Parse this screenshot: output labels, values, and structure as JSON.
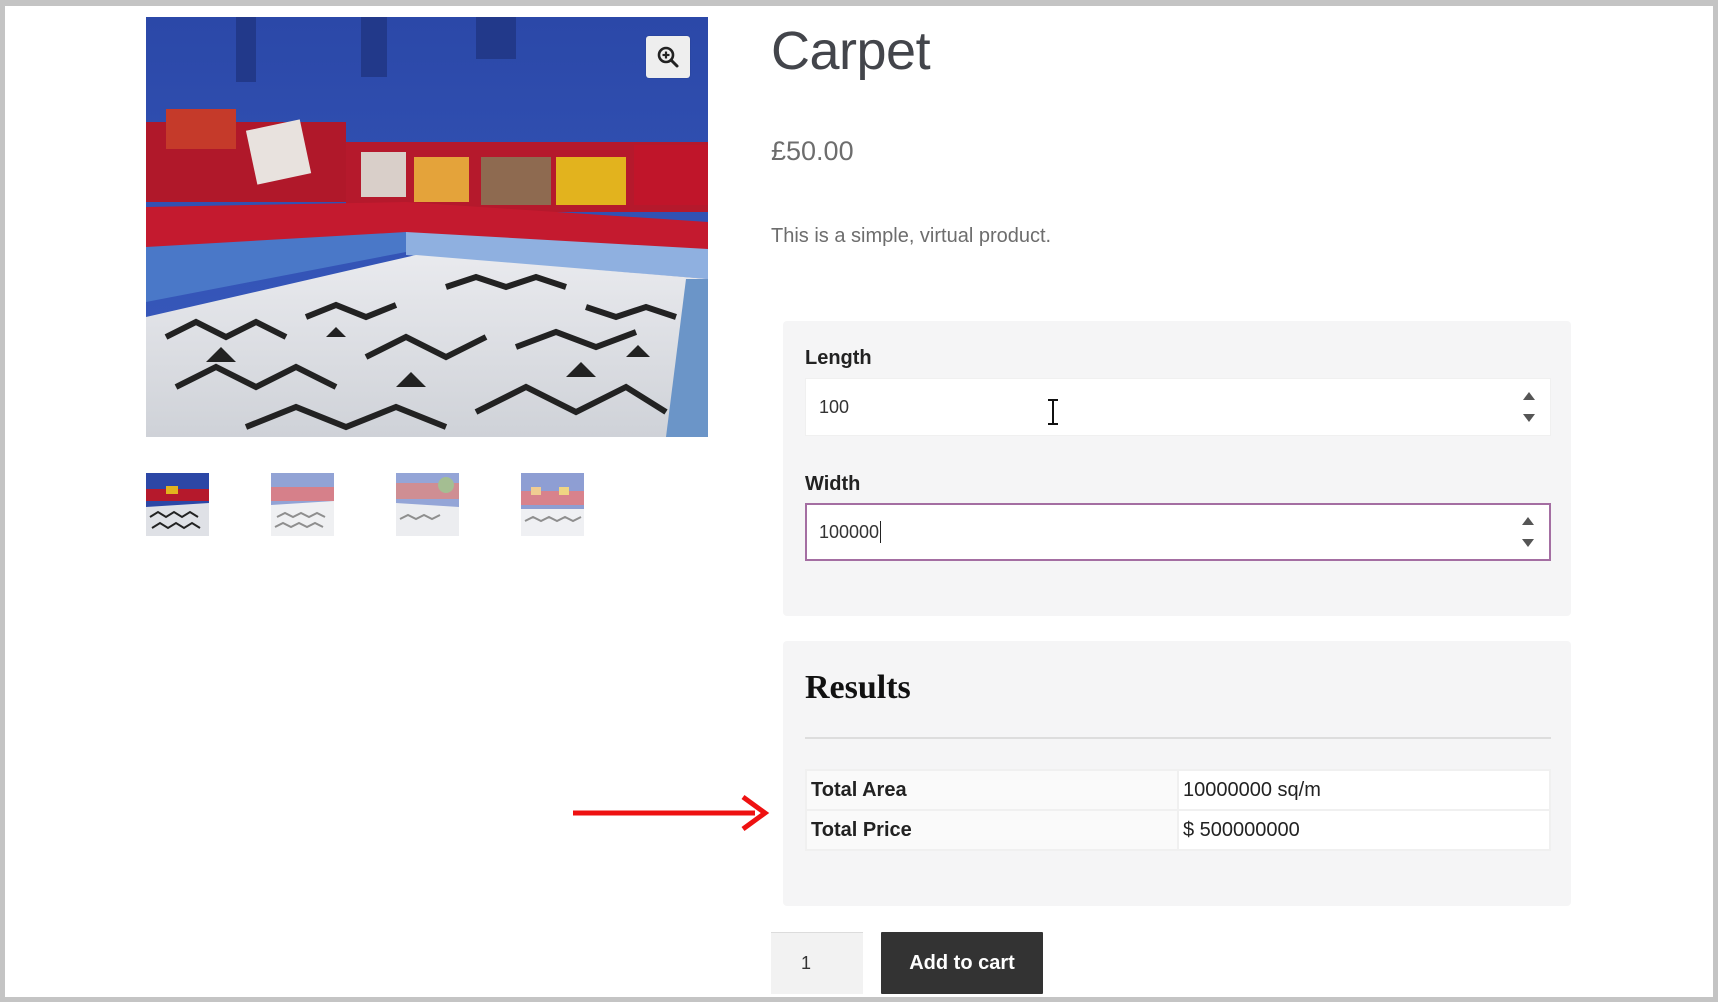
{
  "product": {
    "title": "Carpet",
    "price": "£50.00",
    "description": "This is a simple, virtual product."
  },
  "gallery": {
    "thumbnail_count": 4,
    "active_thumbnail": 1,
    "zoom_icon": "magnifier-plus-icon"
  },
  "calculator": {
    "length_label": "Length",
    "length_value": "100",
    "width_label": "Width",
    "width_value": "100000"
  },
  "results": {
    "title": "Results",
    "rows": [
      {
        "label": "Total Area",
        "value": "10000000 sq/m"
      },
      {
        "label": "Total Price",
        "value": "$ 500000000"
      }
    ]
  },
  "cart": {
    "quantity": "1",
    "add_to_cart_label": "Add to cart"
  },
  "colors": {
    "focus_border": "#a46ea2",
    "button_bg": "#333333",
    "annotation_arrow": "#ee1111",
    "panel_bg": "#f5f5f6"
  }
}
